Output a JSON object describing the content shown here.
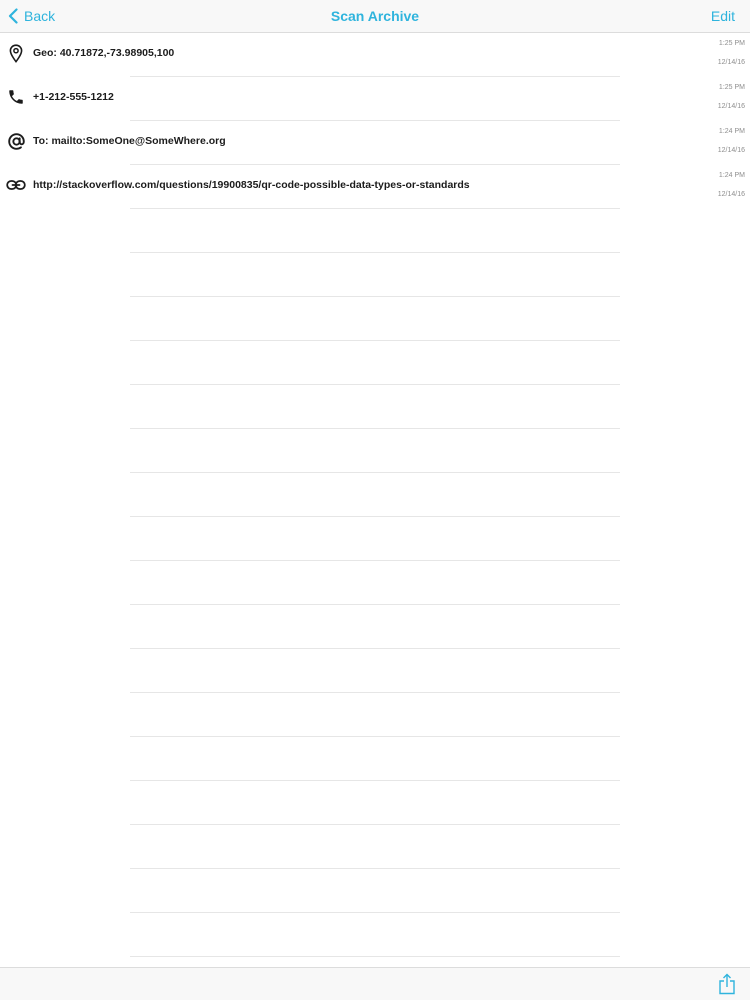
{
  "nav": {
    "back_label": "Back",
    "title": "Scan Archive",
    "edit_label": "Edit"
  },
  "items": [
    {
      "icon": "location-pin-icon",
      "text": "Geo: 40.71872,-73.98905,100",
      "time": "1:25 PM",
      "date": "12/14/16"
    },
    {
      "icon": "phone-icon",
      "text": "+1-212-555-1212",
      "time": "1:25 PM",
      "date": "12/14/16"
    },
    {
      "icon": "at-sign-icon",
      "text": "To: mailto:SomeOne@SomeWhere.org",
      "time": "1:24 PM",
      "date": "12/14/16"
    },
    {
      "icon": "link-icon",
      "text": "http://stackoverflow.com/questions/19900835/qr-code-possible-data-types-or-standards",
      "time": "1:24 PM",
      "date": "12/14/16"
    }
  ],
  "toolbar": {
    "share_icon": "share-icon"
  },
  "colors": {
    "accent": "#2fb4dd",
    "text": "#1c1c1c",
    "subtle": "#8e8e8e",
    "separator": "#e6e6e6",
    "bar": "#f8f8f8"
  }
}
